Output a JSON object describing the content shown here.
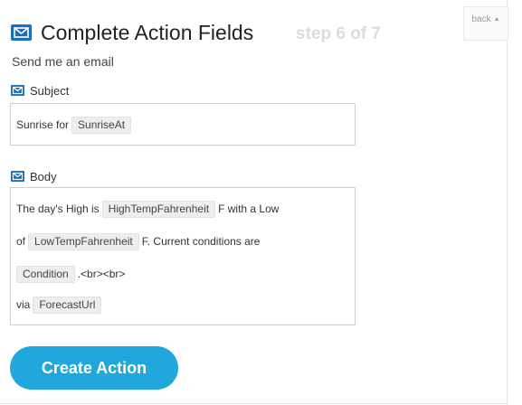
{
  "header": {
    "title": "Complete Action Fields",
    "step": "step 6 of 7",
    "back_label": "back",
    "back_caret": "▲"
  },
  "subtitle": "Send me an email",
  "fields": {
    "subject": {
      "label": "Subject",
      "text_prefix": "Sunrise for",
      "ingredient": "SunriseAt"
    },
    "body": {
      "label": "Body",
      "line1_prefix": "The day's High is",
      "line1_ingredient": "HighTempFahrenheit",
      "line1_suffix": "F with a Low",
      "line2_prefix": "of",
      "line2_ingredient": "LowTempFahrenheit",
      "line2_suffix": "F. Current conditions are",
      "line3_ingredient": "Condition",
      "line3_suffix": ".<br><br>",
      "line4_prefix": "via",
      "line4_ingredient": "ForecastUrl"
    }
  },
  "create_button_label": "Create Action",
  "icons": {
    "header": "envelope-icon",
    "subject": "envelope-icon",
    "body": "envelope-icon"
  },
  "colors": {
    "accent": "#1f6fb8",
    "button": "#20a8dd"
  }
}
